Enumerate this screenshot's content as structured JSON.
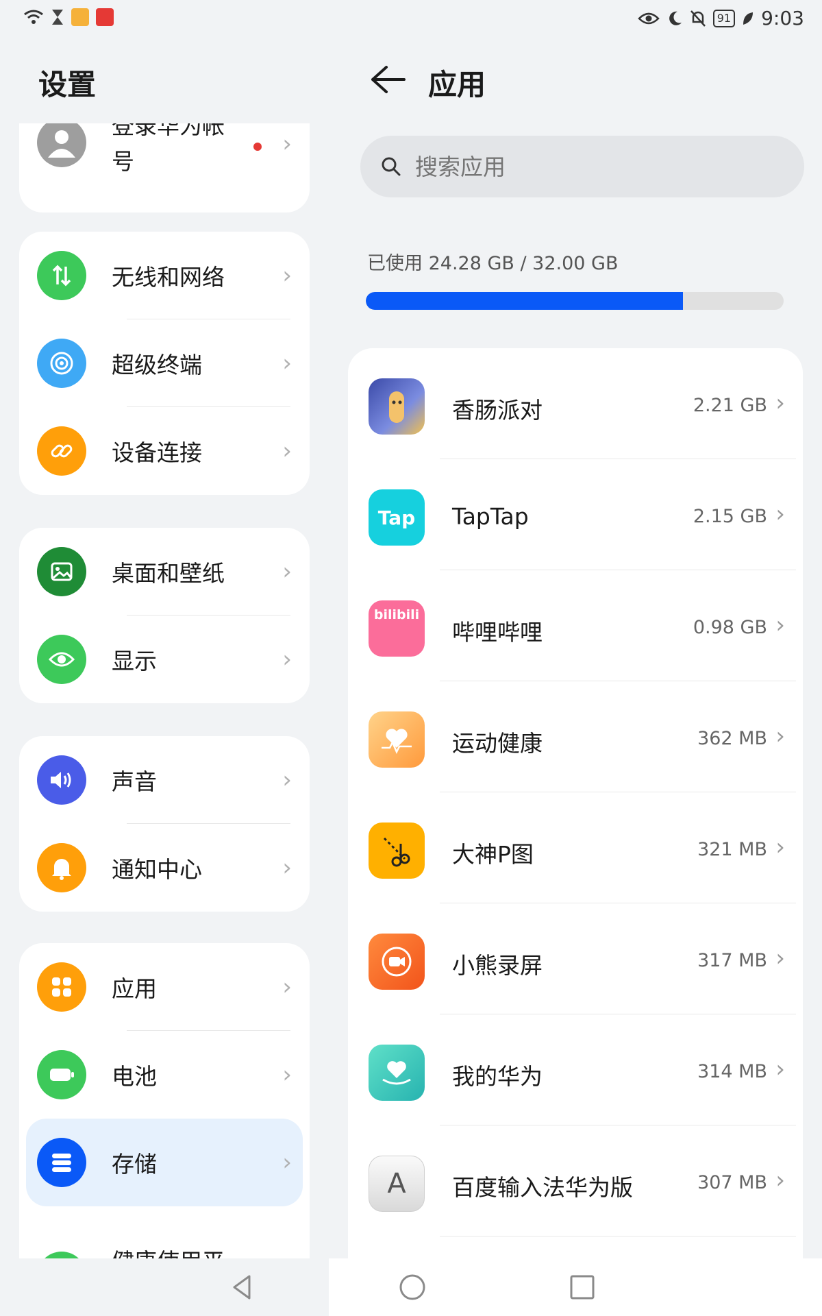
{
  "status_bar": {
    "time": "9:03",
    "battery": "91",
    "left_icons": [
      "wifi-icon",
      "hourglass-icon",
      "app-notification-icon",
      "book-app-icon"
    ],
    "right_icons": [
      "eye-comfort-icon",
      "moon-icon",
      "bell-off-icon",
      "battery-icon",
      "leaf-icon"
    ]
  },
  "left_pane": {
    "title": "设置",
    "account": {
      "label_line1": "登录华为帐",
      "label_line2": "号",
      "has_dot": true
    },
    "groups": [
      {
        "items": [
          {
            "label": "无线和网络",
            "icon": "wireless-network-icon",
            "color": "#3dc95a"
          },
          {
            "label": "超级终端",
            "icon": "super-device-icon",
            "color": "#3fa9f5"
          },
          {
            "label": "设备连接",
            "icon": "link-icon",
            "color": "#ff9f0a"
          }
        ]
      },
      {
        "items": [
          {
            "label": "桌面和壁纸",
            "icon": "wallpaper-icon",
            "color": "#1f8c36"
          },
          {
            "label": "显示",
            "icon": "eye-icon",
            "color": "#3dc95a"
          }
        ]
      },
      {
        "items": [
          {
            "label": "声音",
            "icon": "speaker-icon",
            "color": "#4a5ce8"
          },
          {
            "label": "通知中心",
            "icon": "bell-icon",
            "color": "#ff9f0a"
          }
        ]
      },
      {
        "items": [
          {
            "label": "应用",
            "icon": "apps-grid-icon",
            "color": "#ff9f0a"
          },
          {
            "label": "电池",
            "icon": "battery-setting-icon",
            "color": "#3dc95a"
          },
          {
            "label": "存储",
            "icon": "storage-icon",
            "color": "#0a59f7",
            "selected": true
          },
          {
            "label": "健康使用平",
            "icon": "health-icon",
            "color": "#3dc95a"
          }
        ]
      }
    ]
  },
  "right_pane": {
    "title": "应用",
    "search_placeholder": "搜索应用",
    "storage_usage": "已使用 24.28 GB / 32.00 GB",
    "used_fraction": 0.7588,
    "accent": "#0a59f7",
    "apps": [
      {
        "name": "香肠派对",
        "size": "2.21 GB",
        "icon": "sausage-party-icon"
      },
      {
        "name": "TapTap",
        "size": "2.15 GB",
        "icon": "taptap-icon",
        "icon_text": "Tap"
      },
      {
        "name": "哔哩哔哩",
        "size": "0.98 GB",
        "icon": "bilibili-icon",
        "icon_text": "bilibili"
      },
      {
        "name": "运动健康",
        "size": "362 MB",
        "icon": "health-heart-icon"
      },
      {
        "name": "大神P图",
        "size": "321 MB",
        "icon": "scissors-icon"
      },
      {
        "name": "小熊录屏",
        "size": "317 MB",
        "icon": "screen-record-icon"
      },
      {
        "name": "我的华为",
        "size": "314 MB",
        "icon": "my-huawei-icon"
      },
      {
        "name": "百度输入法华为版",
        "size": "307 MB",
        "icon": "keyboard-a-icon",
        "icon_text": "A"
      }
    ]
  }
}
